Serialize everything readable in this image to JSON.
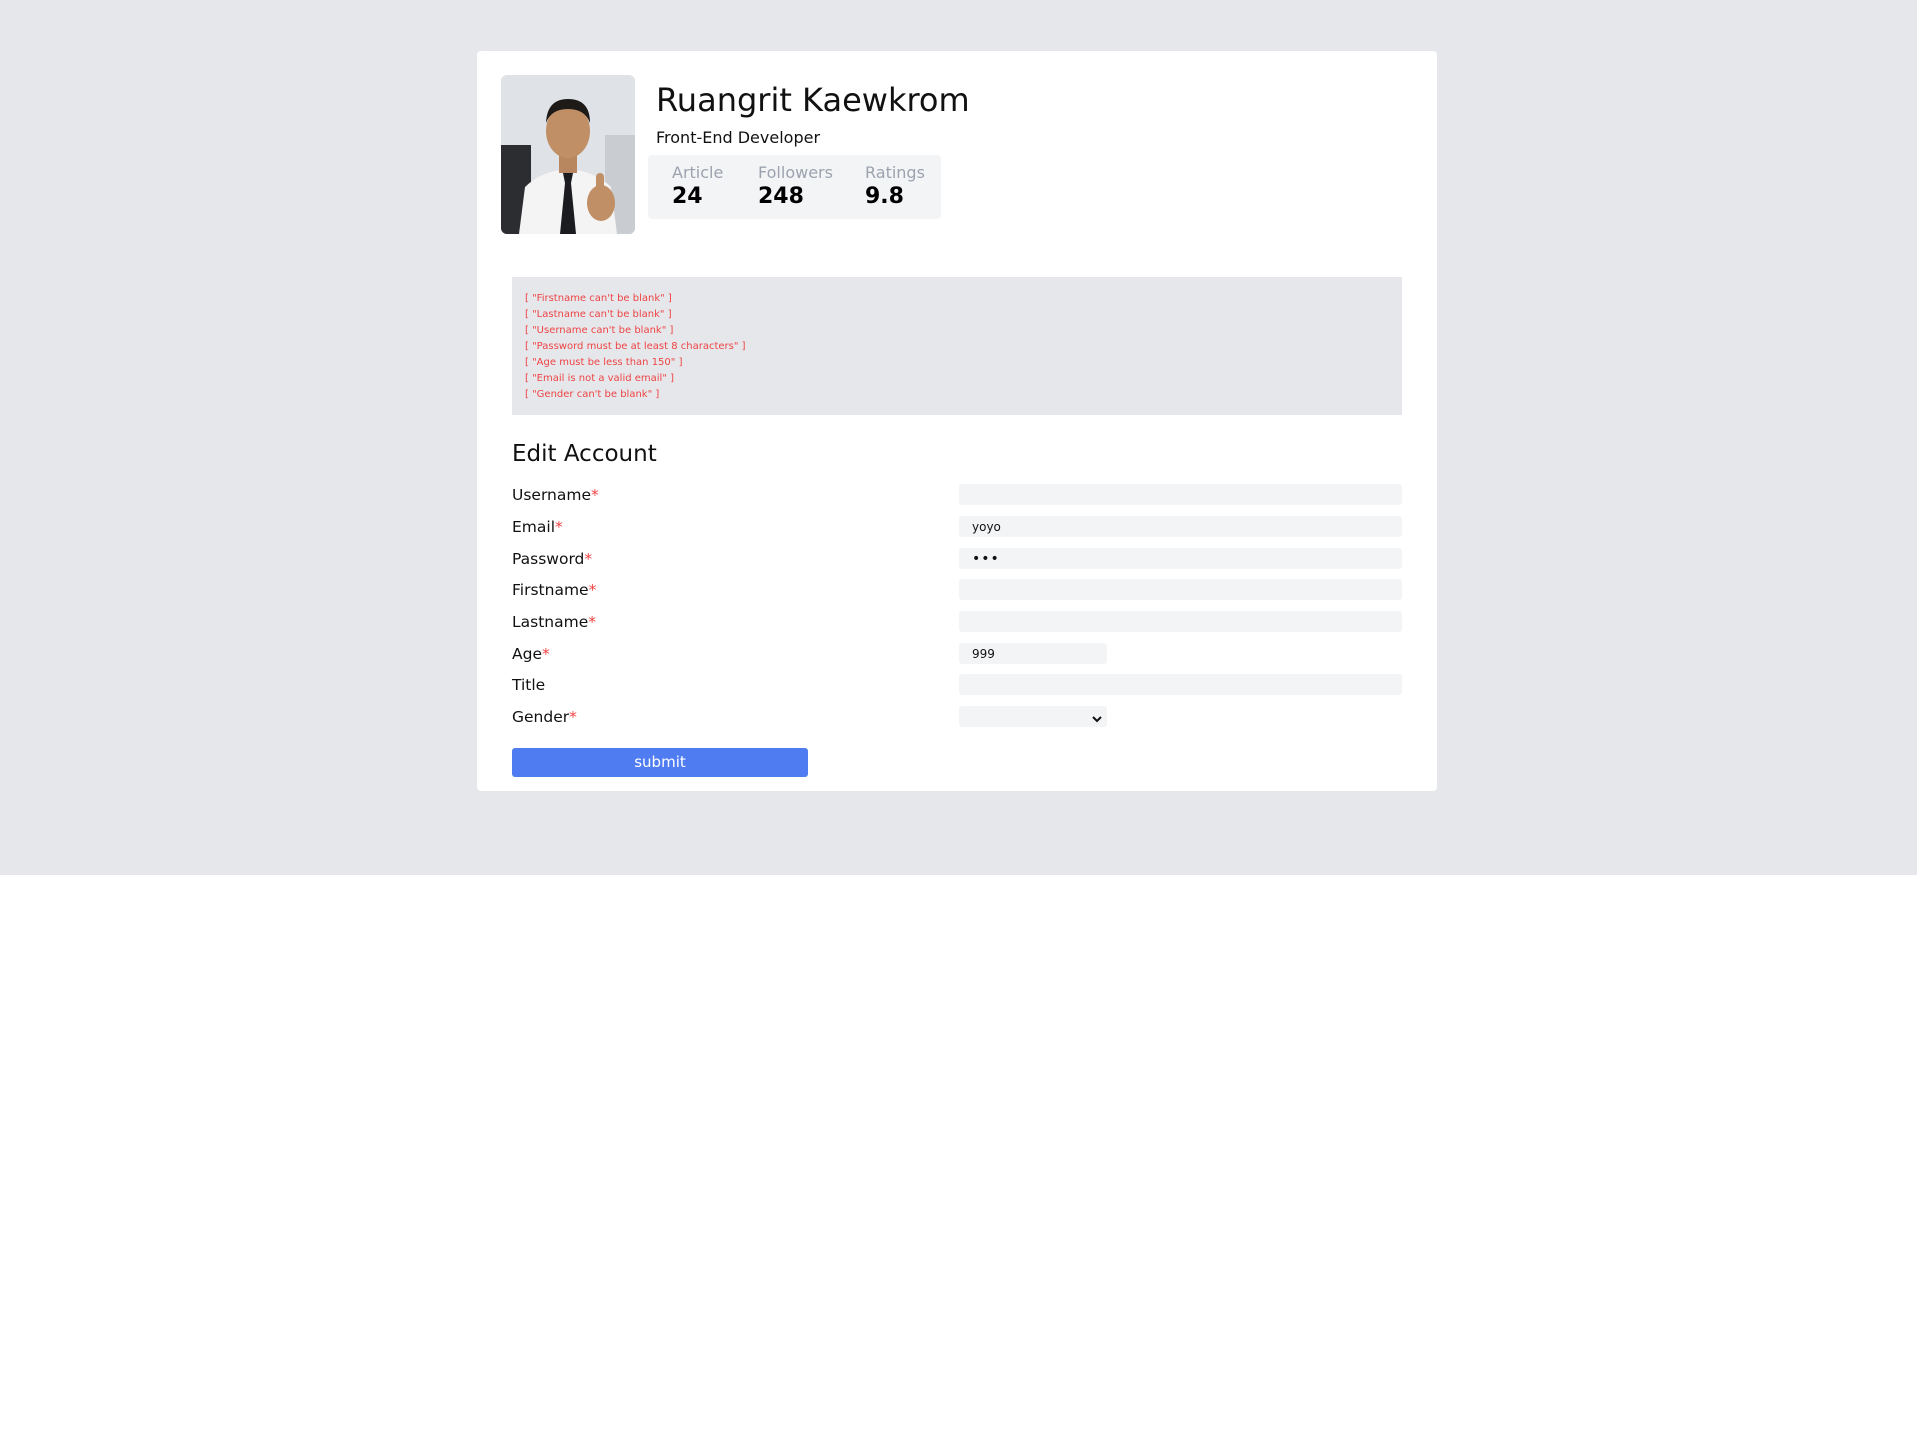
{
  "profile": {
    "name": "Ruangrit Kaewkrom",
    "title": "Front-End Developer",
    "stats": [
      {
        "label": "Article",
        "value": "24"
      },
      {
        "label": "Followers",
        "value": "248"
      },
      {
        "label": "Ratings",
        "value": "9.8"
      }
    ]
  },
  "errors": [
    "[ \"Firstname can't be blank\" ]",
    "[ \"Lastname can't be blank\" ]",
    "[ \"Username can't be blank\" ]",
    "[ \"Password must be at least 8 characters\" ]",
    "[ \"Age must be less than 150\" ]",
    "[ \"Email is not a valid email\" ]",
    "[ \"Gender can't be blank\" ]"
  ],
  "form": {
    "heading": "Edit Account",
    "required_mark": "*",
    "fields": {
      "username": {
        "label": "Username",
        "value": ""
      },
      "email": {
        "label": "Email",
        "value": "yoyo"
      },
      "password": {
        "label": "Password",
        "value": "•••"
      },
      "firstname": {
        "label": "Firstname",
        "value": ""
      },
      "lastname": {
        "label": "Lastname",
        "value": ""
      },
      "age": {
        "label": "Age",
        "value": "999"
      },
      "title": {
        "label": "Title",
        "value": ""
      },
      "gender": {
        "label": "Gender",
        "value": ""
      }
    },
    "submit_label": "submit"
  },
  "icons": {
    "gender_select": "chevron-down-icon"
  },
  "colors": {
    "page_background": "#e5e7eb",
    "card_background": "#ffffff",
    "error_text": "#ef4444",
    "required_mark": "#ef4444",
    "submit_button": "#4f7cf0",
    "input_background": "#f3f4f6",
    "stat_label": "#9ca3af"
  }
}
